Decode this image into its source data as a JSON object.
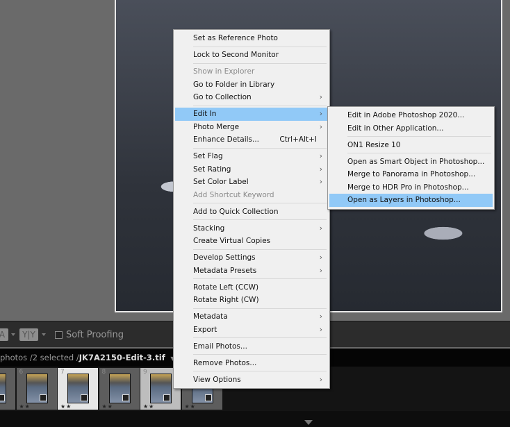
{
  "toolbar": {
    "before_after_label": "A",
    "yy_label": "Y|Y",
    "soft_proofing_label": "Soft Proofing",
    "soft_proofing_checked": false
  },
  "filmstrip": {
    "path_prefix": "photos /2 selected /",
    "filename": "JK7A2150-Edit-3.tif",
    "cells": [
      {
        "num": "",
        "stars": "",
        "selected": false
      },
      {
        "num": "6",
        "stars": "★★",
        "selected": false
      },
      {
        "num": "7",
        "stars": "★★",
        "selected": true
      },
      {
        "num": "8",
        "stars": "★★",
        "selected": false
      },
      {
        "num": "9",
        "stars": "★★",
        "selected": true
      },
      {
        "num": "",
        "stars": "★★",
        "selected": false
      }
    ]
  },
  "context_menu": {
    "items": [
      {
        "label": "Set as Reference Photo"
      },
      {
        "sep": true
      },
      {
        "label": "Lock to Second Monitor"
      },
      {
        "sep": true
      },
      {
        "label": "Show in Explorer",
        "disabled": true
      },
      {
        "label": "Go to Folder in Library"
      },
      {
        "label": "Go to Collection",
        "submenu": true
      },
      {
        "sep": true
      },
      {
        "label": "Edit In",
        "submenu": true,
        "highlighted": true
      },
      {
        "label": "Photo Merge",
        "submenu": true
      },
      {
        "label": "Enhance Details...",
        "shortcut": "Ctrl+Alt+I"
      },
      {
        "sep": true
      },
      {
        "label": "Set Flag",
        "submenu": true
      },
      {
        "label": "Set Rating",
        "submenu": true
      },
      {
        "label": "Set Color Label",
        "submenu": true
      },
      {
        "label": "Add Shortcut Keyword",
        "disabled": true
      },
      {
        "sep": true
      },
      {
        "label": "Add to Quick Collection"
      },
      {
        "sep": true
      },
      {
        "label": "Stacking",
        "submenu": true
      },
      {
        "label": "Create Virtual Copies"
      },
      {
        "sep": true
      },
      {
        "label": "Develop Settings",
        "submenu": true
      },
      {
        "label": "Metadata Presets",
        "submenu": true
      },
      {
        "sep": true
      },
      {
        "label": "Rotate Left (CCW)"
      },
      {
        "label": "Rotate Right (CW)"
      },
      {
        "sep": true
      },
      {
        "label": "Metadata",
        "submenu": true
      },
      {
        "label": "Export",
        "submenu": true
      },
      {
        "sep": true
      },
      {
        "label": "Email Photos..."
      },
      {
        "sep": true
      },
      {
        "label": "Remove Photos..."
      },
      {
        "sep": true
      },
      {
        "label": "View Options",
        "submenu": true
      }
    ]
  },
  "edit_in_submenu": {
    "items": [
      {
        "label": "Edit in Adobe Photoshop 2020..."
      },
      {
        "label": "Edit in Other Application..."
      },
      {
        "sep": true
      },
      {
        "label": "ON1 Resize 10"
      },
      {
        "sep": true
      },
      {
        "label": "Open as Smart Object in Photoshop..."
      },
      {
        "label": "Merge to Panorama in Photoshop..."
      },
      {
        "label": "Merge to HDR Pro in Photoshop..."
      },
      {
        "label": "Open as Layers in Photoshop...",
        "highlighted": true
      }
    ]
  },
  "colors": {
    "highlight": "#91c9f7",
    "menu_bg": "#f0f0f0"
  }
}
